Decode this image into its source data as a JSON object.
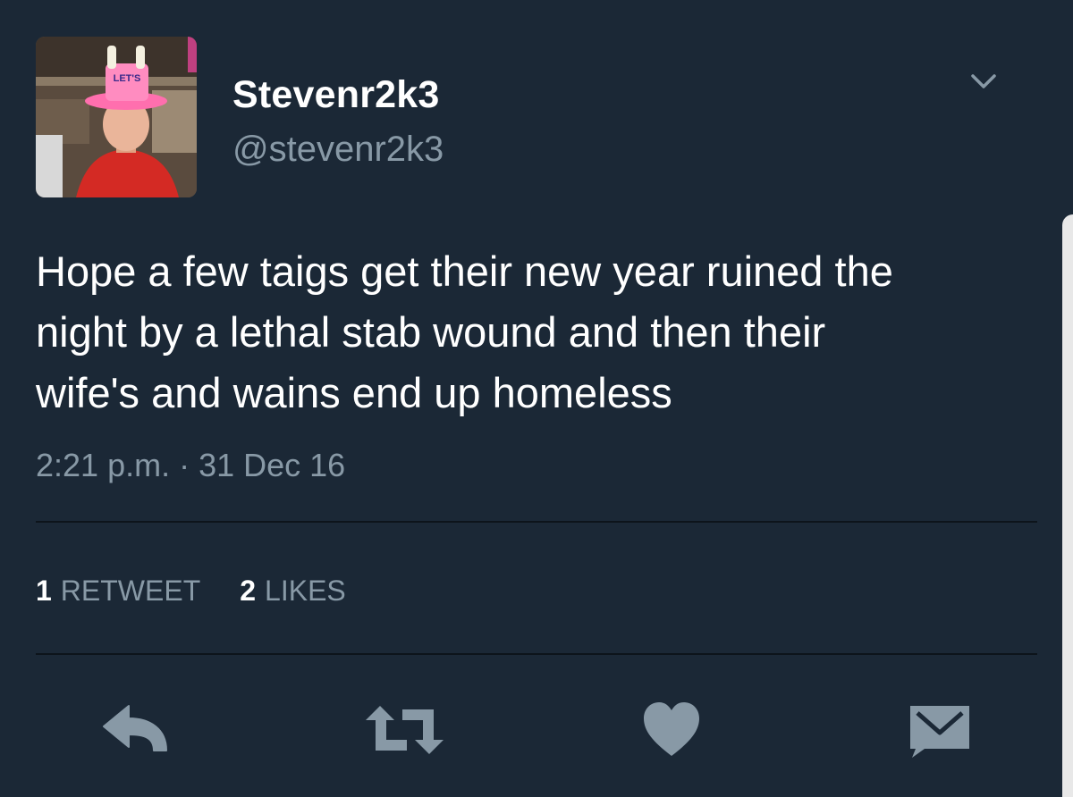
{
  "tweet": {
    "author": {
      "display_name": "Stevenr2k3",
      "handle": "@stevenr2k3",
      "avatar_hat_text": "LET'S"
    },
    "text": "Hope a few taigs get their new year ruined the\nnight by a lethal stab wound and then their\nwife's and wains end up homeless",
    "timestamp": "2:21 p.m. · 31 Dec 16",
    "stats": {
      "retweets_count": "1",
      "retweets_label": "RETWEET",
      "likes_count": "2",
      "likes_label": "LIKES"
    }
  },
  "icons": {
    "menu": "chevron-down-icon",
    "reply": "reply-icon",
    "retweet": "retweet-icon",
    "like": "heart-icon",
    "message": "envelope-icon"
  },
  "colors": {
    "background": "#1b2836",
    "primary_text": "#ffffff",
    "secondary_text": "#8899a6",
    "divider": "#0d141b"
  }
}
